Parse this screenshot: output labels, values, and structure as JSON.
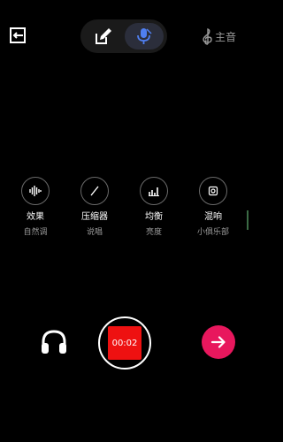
{
  "top": {
    "key_label": "主音",
    "voice_accent": "#4f7ff0"
  },
  "effects": [
    {
      "name": "效果",
      "value": "自然调",
      "icon": "waveform-icon"
    },
    {
      "name": "压缩器",
      "value": "说唱",
      "icon": "slash-icon"
    },
    {
      "name": "均衡",
      "value": "亮度",
      "icon": "equalizer-icon"
    },
    {
      "name": "混响",
      "value": "小俱乐部",
      "icon": "reverb-icon"
    }
  ],
  "controls": {
    "timer": "00:02",
    "record_color": "#ee1111",
    "next_color": "#e8175d"
  }
}
